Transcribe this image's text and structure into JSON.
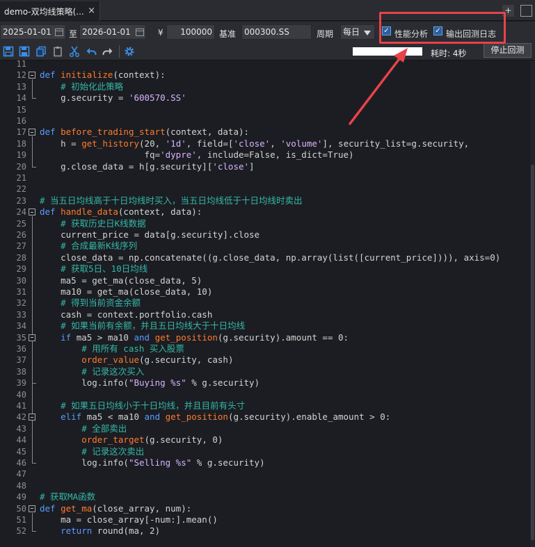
{
  "tab": {
    "title": "demo-双均线策略(...",
    "close": "×",
    "add": "+"
  },
  "params": {
    "start_date": "2025-01-01",
    "to_label": "至",
    "end_date": "2026-01-01",
    "currency": "¥",
    "capital": "100000",
    "benchmark_label": "基准",
    "benchmark": "000300.SS",
    "frequency_label": "周期",
    "frequency": "每日",
    "perf_analysis_label": "性能分析",
    "perf_analysis_checked": true,
    "output_log_label": "输出回测日志",
    "output_log_checked": true,
    "check_mark": "✓"
  },
  "toolbar": {
    "icons": [
      "save-icon",
      "save-as-icon",
      "copy-icon",
      "paste-icon",
      "cut-icon",
      "undo-icon",
      "redo-icon",
      "settings-icon"
    ],
    "progress": 1.0,
    "elapsed": "耗时: 4秒",
    "stop_label": "停止回测"
  },
  "colors": {
    "keyword": "#5b9bff",
    "function": "#ff7b2e",
    "string": "#d9b3ff",
    "comment": "#35b8a8",
    "annotation": "#e8424a",
    "accent": "#2b5f9e"
  },
  "code": {
    "lines": [
      {
        "n": "11",
        "tokens": []
      },
      {
        "n": "12",
        "tokens": [
          [
            "k",
            "def "
          ],
          [
            "f",
            "initialize"
          ],
          [
            "p",
            "(context):"
          ]
        ]
      },
      {
        "n": "13",
        "tokens": [
          [
            "p",
            "    "
          ],
          [
            "c",
            "# 初始化此策略"
          ]
        ]
      },
      {
        "n": "14",
        "tokens": [
          [
            "p",
            "    g.security = "
          ],
          [
            "s",
            "'600570.SS'"
          ]
        ]
      },
      {
        "n": "15",
        "tokens": []
      },
      {
        "n": "16",
        "tokens": []
      },
      {
        "n": "17",
        "tokens": [
          [
            "k",
            "def "
          ],
          [
            "f",
            "before_trading_start"
          ],
          [
            "p",
            "(context, data):"
          ]
        ]
      },
      {
        "n": "18",
        "tokens": [
          [
            "p",
            "    h = "
          ],
          [
            "f",
            "get_history"
          ],
          [
            "p",
            "(20, "
          ],
          [
            "s",
            "'1d'"
          ],
          [
            "p",
            ", field=["
          ],
          [
            "s",
            "'close'"
          ],
          [
            "p",
            ", "
          ],
          [
            "s",
            "'volume'"
          ],
          [
            "p",
            "], security_list=g.security,"
          ]
        ]
      },
      {
        "n": "19",
        "tokens": [
          [
            "p",
            "                    fq="
          ],
          [
            "s",
            "'dypre'"
          ],
          [
            "p",
            ", include=False, is_dict=True)"
          ]
        ]
      },
      {
        "n": "20",
        "tokens": [
          [
            "p",
            "    g.close_data = h[g.security]["
          ],
          [
            "s",
            "'close'"
          ],
          [
            "p",
            "]"
          ]
        ]
      },
      {
        "n": "21",
        "tokens": []
      },
      {
        "n": "22",
        "tokens": []
      },
      {
        "n": "23",
        "tokens": [
          [
            "c",
            "# 当五日均线高于十日均线时买入，当五日均线低于十日均线时卖出"
          ]
        ]
      },
      {
        "n": "24",
        "tokens": [
          [
            "k",
            "def "
          ],
          [
            "f",
            "handle_data"
          ],
          [
            "p",
            "(context, data):"
          ]
        ]
      },
      {
        "n": "25",
        "tokens": [
          [
            "p",
            "    "
          ],
          [
            "c",
            "# 获取历史日K线数据"
          ]
        ]
      },
      {
        "n": "26",
        "tokens": [
          [
            "p",
            "    current_price = data[g.security].close"
          ]
        ]
      },
      {
        "n": "27",
        "tokens": [
          [
            "p",
            "    "
          ],
          [
            "c",
            "# 合成最新K线序列"
          ]
        ]
      },
      {
        "n": "28",
        "tokens": [
          [
            "p",
            "    close_data = np.concatenate((g.close_data, np.array(list([current_price]))), axis=0)"
          ]
        ]
      },
      {
        "n": "29",
        "tokens": [
          [
            "p",
            "    "
          ],
          [
            "c",
            "# 获取5日、10日均线"
          ]
        ]
      },
      {
        "n": "30",
        "tokens": [
          [
            "p",
            "    ma5 = get_ma(close_data, 5)"
          ]
        ]
      },
      {
        "n": "31",
        "tokens": [
          [
            "p",
            "    ma10 = get_ma(close_data, 10)"
          ]
        ]
      },
      {
        "n": "32",
        "tokens": [
          [
            "p",
            "    "
          ],
          [
            "c",
            "# 得到当前资金余额"
          ]
        ]
      },
      {
        "n": "33",
        "tokens": [
          [
            "p",
            "    cash = context.portfolio.cash"
          ]
        ]
      },
      {
        "n": "34",
        "tokens": [
          [
            "p",
            "    "
          ],
          [
            "c",
            "# 如果当前有余额，并且五日均线大于十日均线"
          ]
        ]
      },
      {
        "n": "35",
        "tokens": [
          [
            "p",
            "    "
          ],
          [
            "k",
            "if"
          ],
          [
            "p",
            " ma5 > ma10 "
          ],
          [
            "k",
            "and"
          ],
          [
            "p",
            " "
          ],
          [
            "f",
            "get_position"
          ],
          [
            "p",
            "(g.security).amount == 0:"
          ]
        ]
      },
      {
        "n": "36",
        "tokens": [
          [
            "p",
            "        "
          ],
          [
            "c",
            "# 用所有 cash 买入股票"
          ]
        ]
      },
      {
        "n": "37",
        "tokens": [
          [
            "p",
            "        "
          ],
          [
            "f",
            "order_value"
          ],
          [
            "p",
            "(g.security, cash)"
          ]
        ]
      },
      {
        "n": "38",
        "tokens": [
          [
            "p",
            "        "
          ],
          [
            "c",
            "# 记录这次买入"
          ]
        ]
      },
      {
        "n": "39",
        "tokens": [
          [
            "p",
            "        log.info("
          ],
          [
            "s",
            "\"Buying %s\""
          ],
          [
            "p",
            " % g.security)"
          ]
        ]
      },
      {
        "n": "40",
        "tokens": []
      },
      {
        "n": "41",
        "tokens": [
          [
            "p",
            "    "
          ],
          [
            "c",
            "# 如果五日均线小于十日均线，并且目前有头寸"
          ]
        ]
      },
      {
        "n": "42",
        "tokens": [
          [
            "p",
            "    "
          ],
          [
            "k",
            "elif"
          ],
          [
            "p",
            " ma5 < ma10 "
          ],
          [
            "k",
            "and"
          ],
          [
            "p",
            " "
          ],
          [
            "f",
            "get_position"
          ],
          [
            "p",
            "(g.security).enable_amount > 0:"
          ]
        ]
      },
      {
        "n": "43",
        "tokens": [
          [
            "p",
            "        "
          ],
          [
            "c",
            "# 全部卖出"
          ]
        ]
      },
      {
        "n": "44",
        "tokens": [
          [
            "p",
            "        "
          ],
          [
            "f",
            "order_target"
          ],
          [
            "p",
            "(g.security, 0)"
          ]
        ]
      },
      {
        "n": "45",
        "tokens": [
          [
            "p",
            "        "
          ],
          [
            "c",
            "# 记录这次卖出"
          ]
        ]
      },
      {
        "n": "46",
        "tokens": [
          [
            "p",
            "        log.info("
          ],
          [
            "s",
            "\"Selling %s\""
          ],
          [
            "p",
            " % g.security)"
          ]
        ]
      },
      {
        "n": "47",
        "tokens": []
      },
      {
        "n": "48",
        "tokens": []
      },
      {
        "n": "49",
        "tokens": [
          [
            "c",
            "# 获取MA函数"
          ]
        ]
      },
      {
        "n": "50",
        "tokens": [
          [
            "k",
            "def "
          ],
          [
            "f",
            "get_ma"
          ],
          [
            "p",
            "(close_array, num):"
          ]
        ]
      },
      {
        "n": "51",
        "tokens": [
          [
            "p",
            "    ma = close_array[-num:].mean()"
          ]
        ]
      },
      {
        "n": "52",
        "tokens": [
          [
            "p",
            "    "
          ],
          [
            "k",
            "return"
          ],
          [
            "p",
            " round(ma, 2)"
          ]
        ]
      }
    ]
  }
}
